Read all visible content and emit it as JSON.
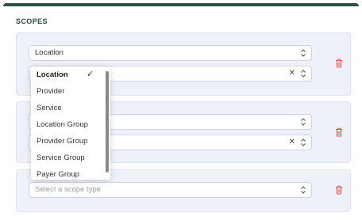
{
  "section": {
    "title": "SCOPES"
  },
  "scopes": [
    {
      "type_value": "Location",
      "has_value_field": true
    },
    {
      "has_value_field": true
    },
    {
      "type_placeholder": "Select a scope type"
    }
  ],
  "dropdown": {
    "options": [
      "Location",
      "Provider",
      "Service",
      "Location Group",
      "Provider Group",
      "Service Group",
      "Payer Group"
    ],
    "selected": "Location"
  },
  "icons": {
    "chevron": "chevron-up-down-icon",
    "clear": "close-icon",
    "delete": "trash-icon",
    "check": "checkmark-icon"
  },
  "colors": {
    "header_bar": "#2f4f46",
    "delete_icon": "#e05a5a",
    "block_bg": "#eef1f8"
  }
}
